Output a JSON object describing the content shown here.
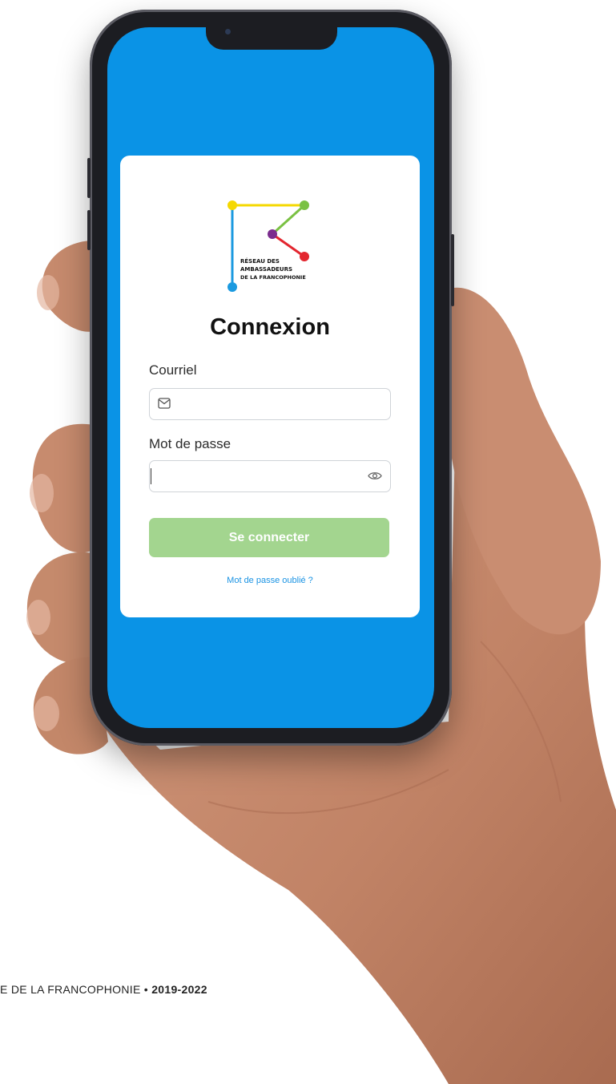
{
  "colors": {
    "screen_bg": "#0a93e6",
    "card_bg": "#ffffff",
    "button_bg": "#a3d58f",
    "link": "#1a93e3",
    "logo_yellow": "#f5d800",
    "logo_green": "#7ac143",
    "logo_purple": "#7b2d8e",
    "logo_red": "#e3262f",
    "logo_blue": "#1b9ae0"
  },
  "logo": {
    "line1": "RÉSEAU DES",
    "line2": "AMBASSADEURS",
    "line3": "DE LA FRANCOPHONIE"
  },
  "login": {
    "title": "Connexion",
    "email_label": "Courriel",
    "email_value": "",
    "email_icon": "mail-icon",
    "password_label": "Mot de passe",
    "password_value": "",
    "password_icon": "eye-icon",
    "submit_label": "Se connecter",
    "forgot_label": "Mot de passe oublié ?"
  },
  "caption": {
    "text": "E DE LA FRANCOPHONIE",
    "separator": "•",
    "years": "2019-2022"
  }
}
